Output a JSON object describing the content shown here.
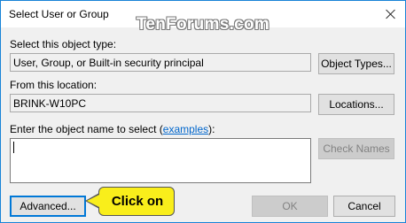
{
  "window": {
    "title": "Select User or Group",
    "watermark": "TenForums.com"
  },
  "object_type": {
    "label": "Select this object type:",
    "value": "User, Group, or Built-in security principal",
    "button": "Object Types..."
  },
  "location": {
    "label": "From this location:",
    "value": "BRINK-W10PC",
    "button": "Locations..."
  },
  "object_name": {
    "label_prefix": "Enter the object name to select (",
    "label_link": "examples",
    "label_suffix": "):",
    "value": "",
    "check_button": "Check Names"
  },
  "footer": {
    "advanced_button": "Advanced...",
    "ok_button": "OK",
    "cancel_button": "Cancel"
  },
  "callout": {
    "text": "Click on",
    "color": "#f9ee1b"
  },
  "colors": {
    "accent": "#1883d7",
    "link": "#0066cc"
  }
}
